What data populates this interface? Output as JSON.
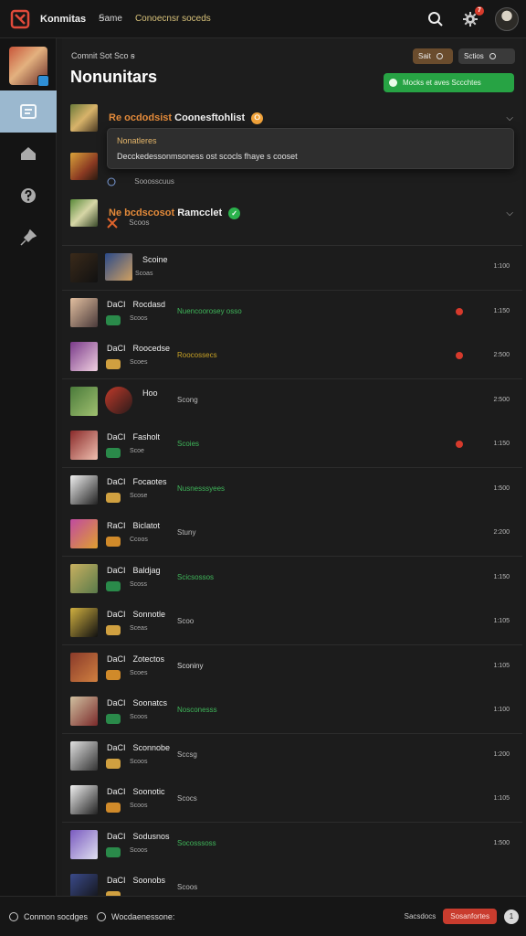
{
  "header": {
    "brand": "Konmitas",
    "nav": [
      "Ꞩame",
      "Conoecnsr soceds"
    ],
    "notification_count": "7"
  },
  "sidebar": {
    "items": [
      "list-icon",
      "home-icon",
      "question-icon",
      "pin-icon"
    ]
  },
  "main": {
    "breadcrumb": "Comnit Sot Sco ꞩ",
    "title": "Nonunitars",
    "filter_pills": [
      "Sait",
      "Sctios"
    ],
    "primary_action": "Mocks et aves Sccchtes",
    "groups": [
      {
        "title_hl": "Re ocdodsist",
        "title_rest": " Coonesftohlist",
        "emoji": "⭘",
        "emoji_color": "#f0a23a"
      },
      {
        "title_hl": "",
        "title_rest": "",
        "sub": "Sooosscuus"
      },
      {
        "title_hl": "Ne bcdscosot",
        "title_rest": " Ramcclet",
        "emoji": "✓",
        "emoji_color": "#2bb24c",
        "sub": "Scoos"
      }
    ],
    "tooltip": {
      "title": "Nonatleres",
      "body": "Decckedessonmsoness ost scocls fhaye s cooset"
    }
  },
  "rows": [
    {
      "prefix": "",
      "name": "Scoine",
      "sub": "Scoas",
      "status": "",
      "status_color": "#aaa",
      "num": "1:100",
      "red": false
    },
    {
      "prefix": "DaCI",
      "name": "Rocdasd",
      "sub": "Scoos",
      "status": "Nuencoorosey osso",
      "status_color": "#3fb65a",
      "num": "1:150",
      "red": true
    },
    {
      "prefix": "DaCI",
      "name": "Roocedse",
      "sub": "Scoes",
      "status": "Roocossecs",
      "status_color": "#c9a326",
      "num": "2:500",
      "red": true
    },
    {
      "prefix": "",
      "name": "Hoo",
      "sub": "",
      "status": "Scong",
      "status_color": "#bbb",
      "num": "2:500",
      "red": false
    },
    {
      "prefix": "DaCI",
      "name": "Fasholt",
      "sub": "Scoe",
      "status": "Scoies",
      "status_color": "#3fb65a",
      "num": "1:150",
      "red": true
    },
    {
      "prefix": "DaCI",
      "name": "Focaotes",
      "sub": "Scose",
      "status": "Nusnesssyees",
      "status_color": "#3fb65a",
      "num": "1:500",
      "red": false
    },
    {
      "prefix": "RaCI",
      "name": "Biclatot",
      "sub": "Ccoos",
      "status": "Stuny",
      "status_color": "#bbb",
      "num": "2:200",
      "red": false
    },
    {
      "prefix": "DaCI",
      "name": "Baldjag",
      "sub": "Scoss",
      "status": "Scicsossos",
      "status_color": "#3fb65a",
      "num": "1:150",
      "red": false
    },
    {
      "prefix": "DaCI",
      "name": "Sonnotle",
      "sub": "Sceas",
      "status": "Scoo",
      "status_color": "#bbb",
      "num": "1:105",
      "red": false
    },
    {
      "prefix": "DaCI",
      "name": "Zotectos",
      "sub": "Scoes",
      "status": "Sconiny",
      "status_color": "#ddd",
      "num": "1:105",
      "red": false
    },
    {
      "prefix": "DaCI",
      "name": "Soonatcs",
      "sub": "Scoos",
      "status": "Nosconesss",
      "status_color": "#3fb65a",
      "num": "1:100",
      "red": false
    },
    {
      "prefix": "DaCI",
      "name": "Sconnobe",
      "sub": "Scoos",
      "status": "Sccsg",
      "status_color": "#bbb",
      "num": "1:200",
      "red": false
    },
    {
      "prefix": "DaCI",
      "name": "Soonotic",
      "sub": "Scoos",
      "status": "Scocs",
      "status_color": "#bbb",
      "num": "1:105",
      "red": false
    },
    {
      "prefix": "DaCI",
      "name": "Sodusnos",
      "sub": "Scoos",
      "status": "Socosssoss",
      "status_color": "#3fb65a",
      "num": "1:500",
      "red": false
    },
    {
      "prefix": "DaCI",
      "name": "Soonobs",
      "sub": "",
      "status": "Scoos",
      "status_color": "#bbb",
      "num": "",
      "red": false
    }
  ],
  "footer": {
    "left_1": "Conmon socdges",
    "left_2": "Wocdaenessone:",
    "right_label": "Sacsdocs",
    "right_button": "Sosanfortes",
    "count": "1"
  },
  "colors": {
    "accent_green": "#27a344",
    "accent_red": "#c93c2e",
    "sidebar_active": "#9bb8cf"
  }
}
